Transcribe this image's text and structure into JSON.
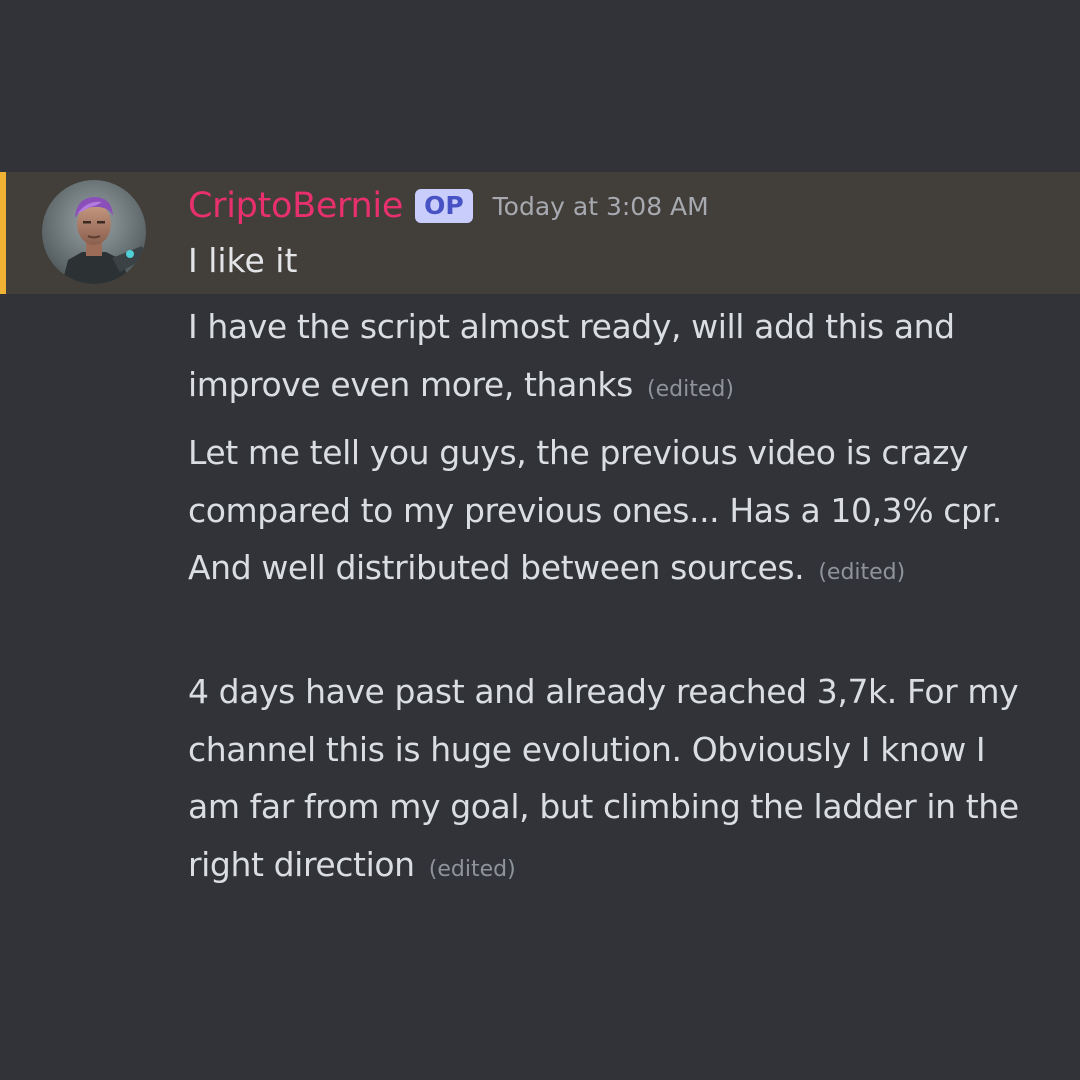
{
  "author": {
    "username": "CriptoBernie",
    "badge": "OP",
    "timestamp": "Today at 3:08 AM",
    "avatar_icon": "user-avatar-icon"
  },
  "messages": [
    {
      "text": "I like it",
      "edited": ""
    },
    {
      "text": "I have the script almost ready, will add this and improve even more, thanks",
      "edited": "(edited)"
    },
    {
      "text": "Let me tell you guys, the previous video is crazy compared to my previous ones... Has a 10,3% cpr. And well distributed between sources.",
      "edited": "(edited)"
    },
    {
      "text": "4 days have past and already reached 3,7k. For my channel this is huge evolution. Obviously I know I am far from my goal, but climbing the ladder in the right direction",
      "edited": "(edited)"
    }
  ],
  "colors": {
    "background": "#313338",
    "highlight": "#423e39",
    "highlight_bar": "#f0b232",
    "username": "#e9306f",
    "text": "#dbdee1"
  }
}
